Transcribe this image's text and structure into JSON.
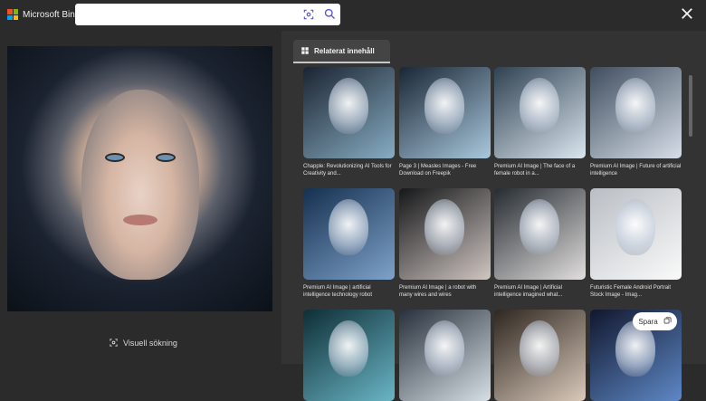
{
  "header": {
    "brand": "Microsoft Bing",
    "search_placeholder": "",
    "visual_search_icon": "visual-search-icon",
    "search_icon": "search-icon",
    "close_icon": "close-icon"
  },
  "left_panel": {
    "visual_search": "Visuell sökning"
  },
  "related": {
    "tab_label": "Relaterat innehåll",
    "items": [
      {
        "caption": "Chapple: Revolutionizing AI Tools for Creativity and...",
        "color_a": "#1b2431",
        "color_b": "#87acc2"
      },
      {
        "caption": "Page 3 | Measles Images - Free Download on Freepik",
        "color_a": "#192634",
        "color_b": "#a9c8dd"
      },
      {
        "caption": "Premium AI Image | The face of a female robot in a...",
        "color_a": "#2f4151",
        "color_b": "#dbe6ef"
      },
      {
        "caption": "Premium AI Image | Future of artificial intelligence",
        "color_a": "#3f4d5e",
        "color_b": "#d6dee8"
      },
      {
        "caption": "Premium AI Image | artificial intelligence technology robot",
        "color_a": "#153050",
        "color_b": "#7ea2c9"
      },
      {
        "caption": "Premium AI Image | a robot with many wires and wires",
        "color_a": "#151719",
        "color_b": "#d0c6c2"
      },
      {
        "caption": "Premium AI Image | Artificial intelligence imagined what...",
        "color_a": "#252b31",
        "color_b": "#e2dfde"
      },
      {
        "caption": "Futuristic Female Android Portrait Stock Image - Imag...",
        "color_a": "#b9bec4",
        "color_b": "#fafafa"
      },
      {
        "caption": "",
        "color_a": "#0e2e36",
        "color_b": "#6ab5c5"
      },
      {
        "caption": "",
        "color_a": "#28313b",
        "color_b": "#d7dfe6"
      },
      {
        "caption": "",
        "color_a": "#2e2620",
        "color_b": "#d9c9ba"
      },
      {
        "caption": "",
        "color_a": "#11172e",
        "color_b": "#5e88c6"
      }
    ]
  },
  "save": {
    "label": "Spara",
    "icon": "save-icon"
  }
}
